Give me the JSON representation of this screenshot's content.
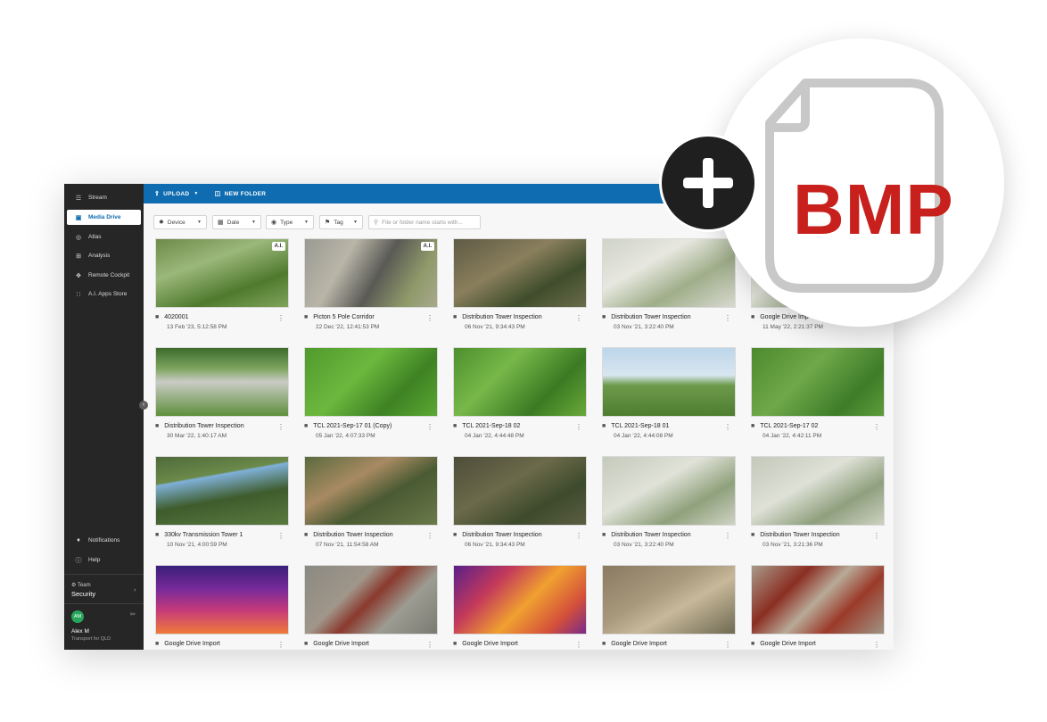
{
  "sidebar": {
    "items": [
      {
        "label": "Stream",
        "icon": "stream-icon"
      },
      {
        "label": "Media Drive",
        "icon": "media-drive-icon",
        "active": true
      },
      {
        "label": "Atlas",
        "icon": "globe-icon"
      },
      {
        "label": "Analysis",
        "icon": "analysis-icon"
      },
      {
        "label": "Remote Cockpit",
        "icon": "cockpit-icon"
      },
      {
        "label": "A.I. Apps Store",
        "icon": "apps-grid-icon"
      }
    ],
    "notifications": "Notifications",
    "help": "Help",
    "team_label": "Team",
    "team_name": "Security",
    "user_initials": "AM",
    "user_name": "Alex M",
    "user_org": "Transport for QLD"
  },
  "toolbar": {
    "upload": "UPLOAD",
    "new_folder": "NEW FOLDER"
  },
  "filters": {
    "device": "Device",
    "date": "Date",
    "type": "Type",
    "tag": "Tag",
    "search_placeholder": "File or folder name starts with..."
  },
  "cards": [
    {
      "title": "4020001",
      "date": "13 Feb '23, 5:12:58 PM",
      "ai": "A.I."
    },
    {
      "title": "Picton 5 Pole Corridor",
      "date": "22 Dec '22, 12:41:53 PM",
      "ai": "A.I."
    },
    {
      "title": "Distribution Tower Inspection",
      "date": "06 Nov '21, 9:34:43 PM"
    },
    {
      "title": "Distribution Tower Inspection",
      "date": "03 Nov '21, 3:22:40 PM"
    },
    {
      "title": "Google Drive Imp",
      "date": "11 May '22, 2:21:37 PM"
    },
    {
      "title": "Distribution Tower Inspection",
      "date": "30 Mar '22, 1:40:17 AM"
    },
    {
      "title": "TCL 2021-Sep-17 01 (Copy)",
      "date": "05 Jan '22, 4:07:33 PM"
    },
    {
      "title": "TCL 2021-Sep-18 02",
      "date": "04 Jan '22, 4:44:48 PM"
    },
    {
      "title": "TCL 2021-Sep-18 01",
      "date": "04 Jan '22, 4:44:08 PM"
    },
    {
      "title": "TCL 2021-Sep-17 02",
      "date": "04 Jan '22, 4:42:11 PM"
    },
    {
      "title": "330kv Transmission Tower 1",
      "date": "10 Nov '21, 4:00:59 PM"
    },
    {
      "title": "Distribution Tower Inspection",
      "date": "07 Nov '21, 11:54:58 AM"
    },
    {
      "title": "Distribution Tower Inspection",
      "date": "06 Nov '21, 9:34:43 PM"
    },
    {
      "title": "Distribution Tower Inspection",
      "date": "03 Nov '21, 3:22:40 PM"
    },
    {
      "title": "Distribution Tower Inspection",
      "date": "03 Nov '21, 3:21:36 PM"
    },
    {
      "title": "Google Drive Import",
      "date": ""
    },
    {
      "title": "Google Drive Import",
      "date": ""
    },
    {
      "title": "Google Drive Import",
      "date": ""
    },
    {
      "title": "Google Drive Import",
      "date": ""
    },
    {
      "title": "Google Drive Import",
      "date": ""
    }
  ],
  "badge": {
    "format": "BMP"
  },
  "colors": {
    "accent": "#0f6cb0",
    "sidebar": "#262626",
    "bmp_red": "#c8201c"
  }
}
